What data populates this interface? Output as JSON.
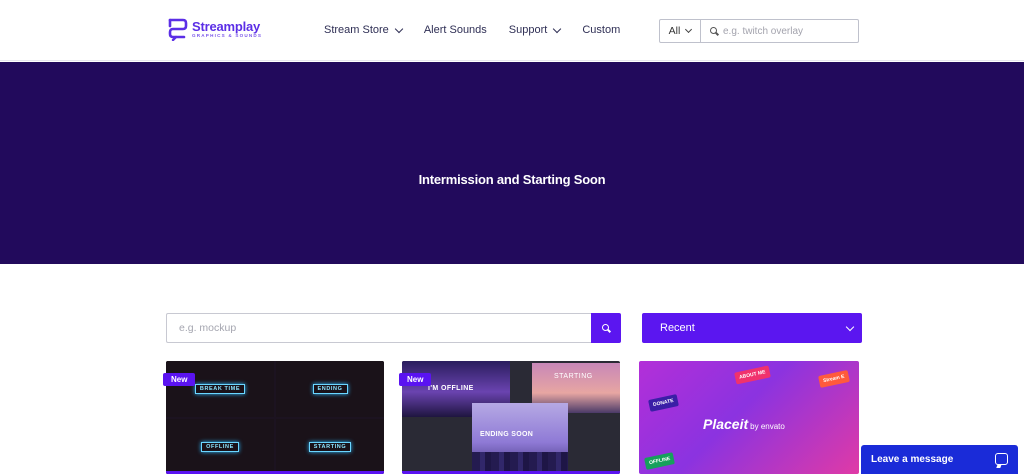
{
  "header": {
    "logo_name": "Streamplay",
    "logo_tagline": "GRAPHICS & SOUNDS",
    "nav": [
      {
        "label": "Stream Store",
        "has_dropdown": true
      },
      {
        "label": "Alert Sounds",
        "has_dropdown": false
      },
      {
        "label": "Support",
        "has_dropdown": true
      },
      {
        "label": "Custom",
        "has_dropdown": false
      }
    ],
    "search": {
      "category": "All",
      "placeholder": "e.g. twitch overlay"
    }
  },
  "hero": {
    "title": "Intermission and Starting Soon",
    "background": "#220a5c"
  },
  "filters": {
    "search_placeholder": "e.g. mockup",
    "sort_value": "Recent",
    "accent": "#5b16f0"
  },
  "products": [
    {
      "badge": "New",
      "tiles": [
        "BREAK TIME",
        "ENDING",
        "OFFLINE",
        "STARTING"
      ]
    },
    {
      "badge": "New",
      "screens": [
        "I'M OFFLINE",
        "STARTING",
        "ENDING SOON"
      ]
    },
    {
      "brand": "Placeit",
      "brand_suffix": "by envato",
      "tags": [
        "DONATE",
        "ABOUT ME",
        "OFFLINE",
        "Stream E"
      ]
    }
  ],
  "chat_widget": {
    "label": "Leave a message",
    "icon": "chat-bubble-icon"
  }
}
